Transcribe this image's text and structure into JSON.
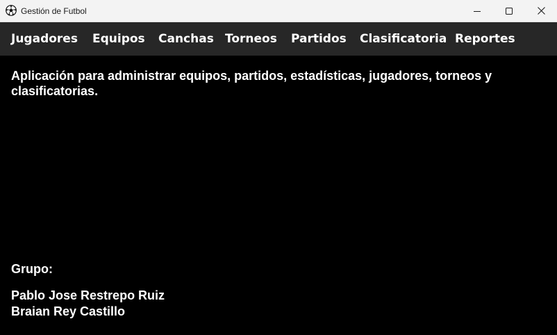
{
  "window": {
    "title": "Gestión de Futbol",
    "app_icon": "soccer-ball-icon",
    "controls": [
      "minimize-icon",
      "maximize-icon",
      "close-icon"
    ]
  },
  "menu": {
    "items": [
      {
        "label": "Jugadores"
      },
      {
        "label": "Equipos"
      },
      {
        "label": "Canchas"
      },
      {
        "label": "Torneos"
      },
      {
        "label": "Partidos"
      },
      {
        "label": "Clasificatoria"
      },
      {
        "label": "Reportes"
      }
    ]
  },
  "content": {
    "description": "Aplicación para administrar equipos, partidos, estadísticas, jugadores, torneos y clasificatorias.",
    "group_label": "Grupo:",
    "members": [
      "Pablo Jose Restrepo Ruiz",
      "Braian Rey Castillo"
    ]
  },
  "colors": {
    "background": "#000000",
    "menubar": "#272727",
    "titlebar": "#f3f3f3",
    "text": "#ffffff"
  }
}
